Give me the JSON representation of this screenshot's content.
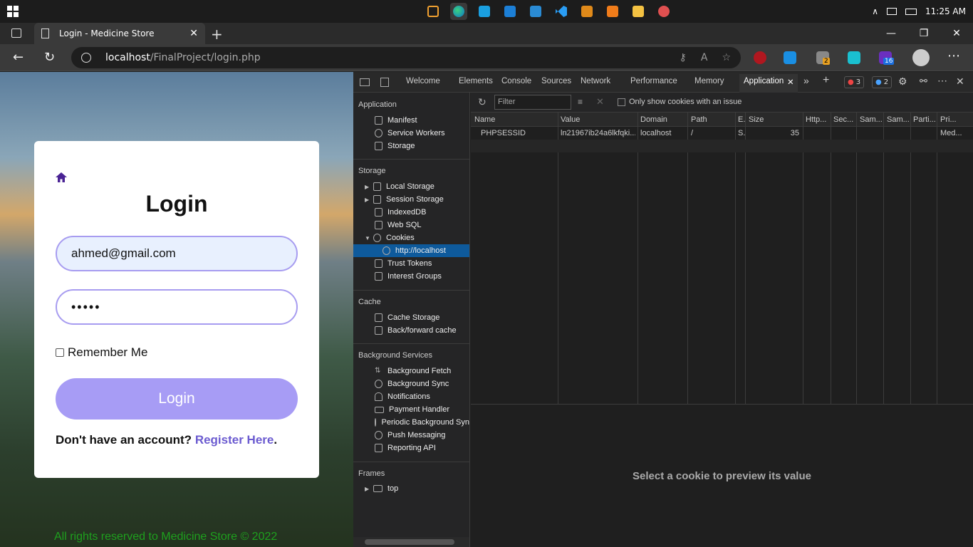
{
  "taskbar": {
    "time": "11:25 AM",
    "tray_caret": "∧"
  },
  "browser": {
    "tab_title": "Login - Medicine Store",
    "tab_close": "✕",
    "new_tab": "+",
    "url_host": "localhost",
    "url_path": "/FinalProject/login.php",
    "ext_badge_1": "2",
    "ext_badge_2": "16"
  },
  "page": {
    "title": "Login",
    "email_value": "ahmed@gmail.com",
    "password_value": "•••••",
    "remember_label": "Remember Me",
    "login_button": "Login",
    "register_prompt": "Don't have an account?",
    "register_link": "Register Here",
    "register_period": ".",
    "footer": "All rights reserved to Medicine Store © 2022"
  },
  "devtools": {
    "tabs": [
      "Welcome",
      "Elements",
      "Console",
      "Sources",
      "Network",
      "Performance",
      "Memory",
      "Application"
    ],
    "active_tab_close": "✕",
    "errors": "3",
    "messages": "2",
    "sidebar": {
      "application_title": "Application",
      "application_items": [
        "Manifest",
        "Service Workers",
        "Storage"
      ],
      "storage_title": "Storage",
      "storage_items": [
        "Local Storage",
        "Session Storage",
        "IndexedDB",
        "Web SQL",
        "Cookies",
        "http://localhost",
        "Trust Tokens",
        "Interest Groups"
      ],
      "cache_title": "Cache",
      "cache_items": [
        "Cache Storage",
        "Back/forward cache"
      ],
      "bg_title": "Background Services",
      "bg_items": [
        "Background Fetch",
        "Background Sync",
        "Notifications",
        "Payment Handler",
        "Periodic Background Syn",
        "Push Messaging",
        "Reporting API"
      ],
      "frames_title": "Frames",
      "frames_items": [
        "top"
      ]
    },
    "filter_placeholder": "Filter",
    "only_issue_label": "Only show cookies with an issue",
    "columns": [
      "Name",
      "Value",
      "Domain",
      "Path",
      "E..",
      "Size",
      "Http...",
      "Sec...",
      "Sam...",
      "Sam...",
      "Parti...",
      "Pri..."
    ],
    "rows": [
      {
        "name": "PHPSESSID",
        "value": "ln21967ib24a6lkfqki...",
        "domain": "localhost",
        "path": "/",
        "expires": "S..",
        "size": "35",
        "priority": "Med..."
      }
    ],
    "preview_text": "Select a cookie to preview its value"
  }
}
